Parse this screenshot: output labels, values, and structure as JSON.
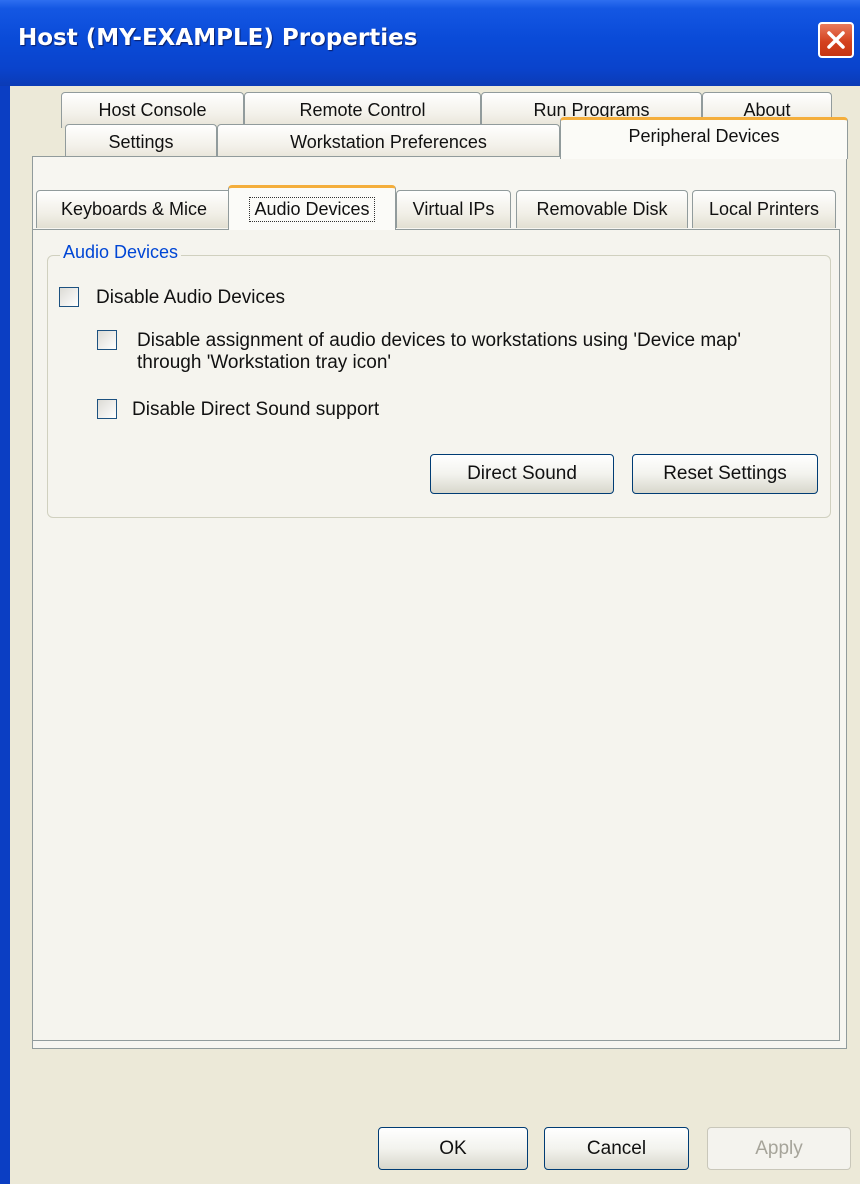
{
  "window": {
    "title": "Host (MY-EXAMPLE) Properties",
    "close_icon": "close-icon"
  },
  "main_tabs": {
    "row_back": [
      "Host Console",
      "Remote Control",
      "Run Programs",
      "About"
    ],
    "row_front": [
      "Settings",
      "Workstation Preferences",
      "Peripheral Devices"
    ],
    "active": "Peripheral Devices"
  },
  "sub_tabs": {
    "items": [
      "Keyboards & Mice",
      "Audio Devices",
      "Virtual IPs",
      "Removable Disk",
      "Local Printers"
    ],
    "active": "Audio Devices"
  },
  "audio_group": {
    "title": "Audio Devices",
    "disable_audio": {
      "label": "Disable Audio Devices",
      "checked": false
    },
    "disable_assignment": {
      "label": "Disable assignment of audio devices to workstations using 'Device map' through 'Workstation tray icon'",
      "checked": false
    },
    "disable_direct_sound": {
      "label": "Disable Direct Sound support",
      "checked": false
    },
    "direct_sound_button": "Direct Sound",
    "reset_button": "Reset Settings"
  },
  "footer": {
    "ok": "OK",
    "cancel": "Cancel",
    "apply": "Apply"
  },
  "colors": {
    "title_bar": "#0a4bd8",
    "active_tab_accent": "#f4ae3c",
    "group_title": "#0046d5",
    "dialog_face": "#ece9d8"
  }
}
